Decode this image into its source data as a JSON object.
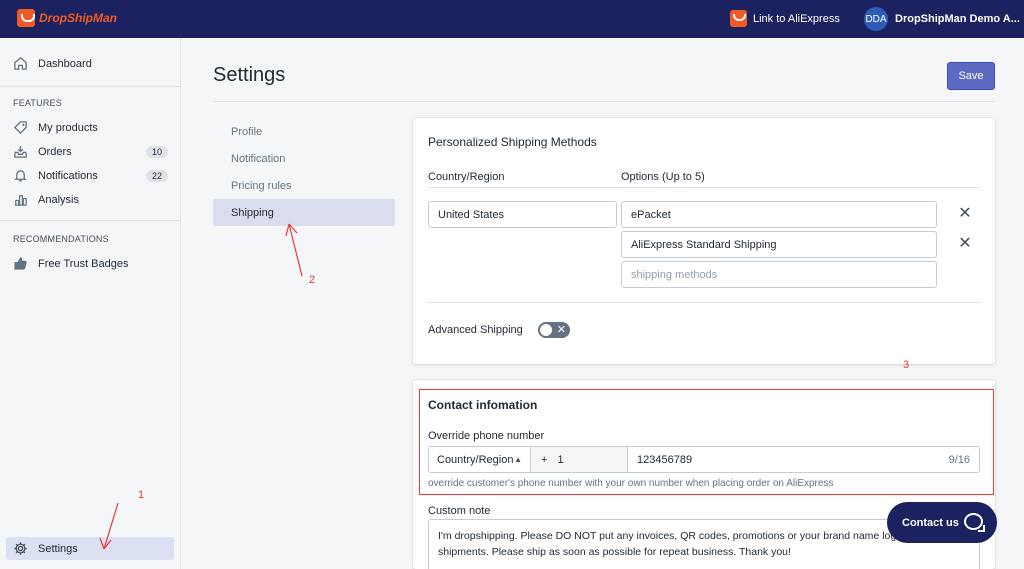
{
  "app": {
    "logo_text": "DropShipMan",
    "link_aliexpress": "Link to AliExpress",
    "user_initials": "DDA",
    "user_name": "DropShipMan Demo A..."
  },
  "sidebar": {
    "dashboard": "Dashboard",
    "features_title": "FEATURES",
    "items": [
      {
        "label": "My products",
        "icon": "tag-icon"
      },
      {
        "label": "Orders",
        "icon": "inbox-icon",
        "badge": "10"
      },
      {
        "label": "Notifications",
        "icon": "bell-icon",
        "badge": "22"
      },
      {
        "label": "Analysis",
        "icon": "chart-icon"
      }
    ],
    "recommendations_title": "RECOMMENDATIONS",
    "free_trust_badges": "Free Trust Badges",
    "settings": "Settings"
  },
  "page": {
    "title": "Settings",
    "save_label": "Save"
  },
  "subnav": {
    "items": [
      "Profile",
      "Notification",
      "Pricing rules",
      "Shipping"
    ],
    "active": "Shipping"
  },
  "shipping": {
    "card_title": "Personalized Shipping Methods",
    "col_country": "Country/Region",
    "col_options": "Options (Up to 5)",
    "country_value": "United States",
    "options": [
      "ePacket",
      "AliExpress Standard Shipping"
    ],
    "option_placeholder": "shipping methods",
    "advanced_label": "Advanced Shipping",
    "advanced_enabled": false
  },
  "contact": {
    "card_title": "Contact infomation",
    "phone_label": "Override phone number",
    "country_select": "Country/Region",
    "plus": "+",
    "dial_code": "1",
    "phone_value": "123456789",
    "char_count": "9/16",
    "help_text": "override customer's phone number with your own number when placing order on AliExpress",
    "custom_note_label": "Custom note",
    "custom_note_value": "I'm dropshipping. Please DO NOT put any invoices, QR codes, promotions or your brand name logo in the shipments. Please ship as soon as possible for repeat business. Thank you!"
  },
  "annotations": [
    "1",
    "2",
    "3"
  ],
  "chat": {
    "label": "Contact us"
  },
  "colors": {
    "topbar": "#1c2260",
    "brand": "#f15a24",
    "primary": "#5c6ac4",
    "annotation": "#e53935"
  }
}
